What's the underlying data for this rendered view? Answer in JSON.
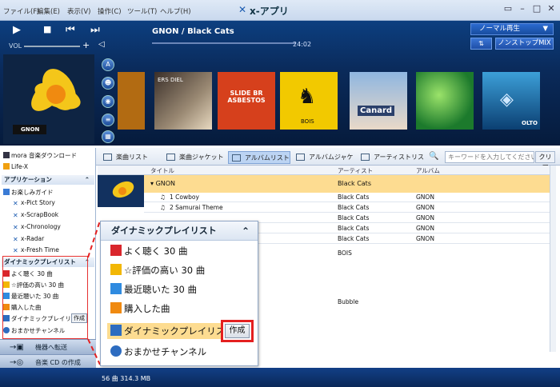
{
  "menubar": {
    "items": [
      "ファイル(F)",
      "編集(E)",
      "表示(V)",
      "操作(C)",
      "ツール(T)",
      "ヘルプ(H)"
    ],
    "app_title": "x-アプリ"
  },
  "player": {
    "track": "GNON / Black Cats",
    "time": "24:02",
    "vol_label": "VOL",
    "mode": "ノーマル再生",
    "nonstop": "ノンストップMIX",
    "albums": [
      {
        "label": "ERS DIEL",
        "color": "#6d5a4a"
      },
      {
        "label": "SLIDE BR ASBESTOS",
        "color": "#d8411a"
      },
      {
        "label": "BOIS",
        "color": "#f0c800"
      },
      {
        "label": "Canard",
        "color": "#5c7fb0"
      },
      {
        "label": "",
        "color": "#39a33b"
      },
      {
        "label": "OLTO",
        "color": "#1b5d8f"
      }
    ],
    "now_art_label": "GNON"
  },
  "tabs": [
    "楽曲リスト",
    "楽曲ジャケット",
    "アルバムリスト",
    "アルバムジャケット",
    "アーティストリスト"
  ],
  "search": {
    "placeholder": "キーワードを入力してください",
    "clear": "クリア"
  },
  "sidebar": {
    "top_items": [
      "mora 音楽ダウンロード",
      "Life-X"
    ],
    "app_header": "アプリケーション",
    "apps": [
      "お楽しみガイド",
      "x-Pict Story",
      "x-ScrapBook",
      "x-Chronology",
      "x-Radar",
      "x-Fresh Time"
    ],
    "dyn_header": "ダイナミックプレイリスト",
    "dyn_items": [
      "よく聴く 30 曲",
      "☆評価の高い 30 曲",
      "最近聴いた 30 曲",
      "購入した曲",
      "ダイナミックプレイリスト",
      "おまかせチャンネル"
    ],
    "create": "作成",
    "transfer": "機器へ転送",
    "cd": "音楽 CD の作成"
  },
  "list": {
    "col_title": "タイトル",
    "col_artist": "アーティスト",
    "col_album": "アルバム",
    "group": "GNON",
    "group_artist": "Black Cats",
    "rows": [
      {
        "title": "1 Cowboy",
        "artist": "Black Cats",
        "album": "GNON"
      },
      {
        "title": "2 Samurai Theme",
        "artist": "Black Cats",
        "album": "GNON"
      },
      {
        "title": "",
        "artist": "Black Cats",
        "album": "GNON"
      },
      {
        "title": "",
        "artist": "Black Cats",
        "album": "GNON"
      },
      {
        "title": "",
        "artist": "Black Cats",
        "album": "GNON"
      }
    ],
    "extra1": "BOIS",
    "extra2": "Bubble"
  },
  "status": "56 曲 314.3 MB",
  "zoom": {
    "header": "ダイナミックプレイリスト",
    "items": [
      "よく聴く 30 曲",
      "☆評価の高い 30 曲",
      "最近聴いた 30 曲",
      "購入した曲",
      "ダイナミックプレイリスト",
      "おまかせチャンネル"
    ],
    "create": "作成"
  }
}
